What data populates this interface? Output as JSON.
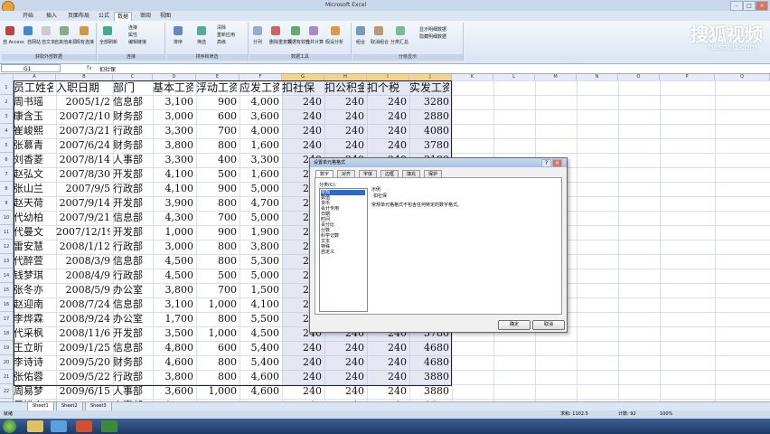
{
  "window": {
    "title": "Microsoft Excel"
  },
  "ribbon": {
    "tabs": [
      "开始",
      "插入",
      "页面布局",
      "公式",
      "数据",
      "审阅",
      "视图"
    ],
    "active_tab": "数据",
    "groups": [
      {
        "label": "获取外部数据",
        "buttons": [
          "自 Access",
          "自网站",
          "自文本",
          "自其他来源",
          "现有连接"
        ]
      },
      {
        "label": "连接",
        "buttons": [
          "全部刷新",
          "连接",
          "属性",
          "编辑链接"
        ]
      },
      {
        "label": "排序和筛选",
        "buttons": [
          "排序",
          "筛选",
          "清除",
          "重新应用",
          "高级"
        ]
      },
      {
        "label": "数据工具",
        "buttons": [
          "分列",
          "删除重复项",
          "数据有效性",
          "合并计算",
          "假设分析"
        ]
      },
      {
        "label": "分级显示",
        "buttons": [
          "组合",
          "取消组合",
          "分类汇总",
          "显示明细数据",
          "隐藏明细数据"
        ]
      }
    ]
  },
  "watermark": {
    "brand": "搜狐视频",
    "url": "tv.sohu.com"
  },
  "formula_bar": {
    "name_box": "G1",
    "fx": "fx",
    "value": "扣社保"
  },
  "columns": [
    "A",
    "B",
    "C",
    "D",
    "E",
    "F",
    "G",
    "H",
    "I",
    "J",
    "K",
    "L",
    "M",
    "N",
    "O",
    "P",
    "Q"
  ],
  "row_numbers": [
    "1",
    "2",
    "3",
    "4",
    "5",
    "6",
    "7",
    "8",
    "9",
    "10",
    "11",
    "12",
    "13",
    "14",
    "15",
    "16",
    "17",
    "18",
    "19",
    "20",
    "21",
    "22"
  ],
  "table": {
    "headers": [
      "员工姓名",
      "入职日期",
      "部门",
      "基本工资",
      "浮动工资",
      "应发工资",
      "扣社保",
      "扣公积金",
      "扣个税",
      "实发工资"
    ],
    "rows": [
      [
        "周书瑶",
        "2005/1/2",
        "信息部",
        "3,100",
        "900",
        "4,000",
        "240",
        "240",
        "240",
        "3280"
      ],
      [
        "康含玉",
        "2007/2/10",
        "财务部",
        "3,000",
        "600",
        "3,600",
        "240",
        "240",
        "240",
        "2880"
      ],
      [
        "崔峻熙",
        "2007/3/21",
        "行政部",
        "3,300",
        "700",
        "4,000",
        "240",
        "240",
        "240",
        "4080"
      ],
      [
        "张慕青",
        "2007/6/24",
        "财务部",
        "3,800",
        "800",
        "1,600",
        "240",
        "240",
        "240",
        "3780"
      ],
      [
        "刘香菱",
        "2007/8/14",
        "人事部",
        "3,300",
        "400",
        "3,300",
        "240",
        "240",
        "240",
        "3180"
      ],
      [
        "赵弘文",
        "2007/8/30",
        "开发部",
        "4,100",
        "500",
        "1,600",
        "240",
        "240",
        "240",
        "3880"
      ],
      [
        "张山兰",
        "2007/9/5",
        "行政部",
        "4,100",
        "900",
        "5,000",
        "240",
        "240",
        "240",
        "4180"
      ],
      [
        "赵天荷",
        "2007/9/14",
        "开发部",
        "3,900",
        "800",
        "4,700",
        "240",
        "240",
        "240",
        "3980"
      ],
      [
        "代幼柏",
        "2007/9/21",
        "信息部",
        "4,300",
        "700",
        "5,000",
        "240",
        "240",
        "240",
        "4280"
      ],
      [
        "代曼文",
        "2007/12/19",
        "开发部",
        "1,000",
        "900",
        "1,900",
        "240",
        "240",
        "240",
        "1180"
      ],
      [
        "雷安慧",
        "2008/1/12",
        "行政部",
        "3,000",
        "800",
        "3,800",
        "240",
        "240",
        "240",
        "3080"
      ],
      [
        "代醉萱",
        "2008/3/9",
        "信息部",
        "4,500",
        "800",
        "5,300",
        "240",
        "240",
        "240",
        "4580"
      ],
      [
        "钱梦琪",
        "2008/4/9",
        "行政部",
        "4,500",
        "500",
        "5,000",
        "240",
        "240",
        "240",
        "4280"
      ],
      [
        "张冬亦",
        "2008/5/9",
        "办公室",
        "3,800",
        "700",
        "1,500",
        "240",
        "240",
        "240",
        "3780"
      ],
      [
        "赵迎南",
        "2008/7/24",
        "信息部",
        "3,100",
        "1,000",
        "4,100",
        "240",
        "240",
        "240",
        "3380"
      ],
      [
        "李烨霖",
        "2008/9/24",
        "办公室",
        "1,700",
        "800",
        "5,500",
        "240",
        "240",
        "240",
        "4780"
      ],
      [
        "代采枫",
        "2008/11/6",
        "开发部",
        "3,500",
        "1,000",
        "4,500",
        "240",
        "240",
        "240",
        "3780"
      ],
      [
        "王立昕",
        "2009/1/25",
        "信息部",
        "4,800",
        "600",
        "5,400",
        "240",
        "240",
        "240",
        "4680"
      ],
      [
        "李诗诗",
        "2009/5/20",
        "财务部",
        "4,600",
        "800",
        "5,400",
        "240",
        "240",
        "240",
        "4680"
      ],
      [
        "张佑蓉",
        "2009/5/22",
        "行政部",
        "3,800",
        "800",
        "4,600",
        "240",
        "240",
        "240",
        "3880"
      ],
      [
        "周易梦",
        "2009/6/15",
        "人事部",
        "3,600",
        "1,000",
        "4,600",
        "240",
        "240",
        "240",
        "3880"
      ],
      [
        "周惜文",
        "2009/7/13",
        "人事部",
        "1,300",
        "900",
        "5,200",
        "240",
        "240",
        "240",
        "4480"
      ]
    ]
  },
  "dialog": {
    "title": "设置单元格格式",
    "tabs": [
      "数字",
      "对齐",
      "字体",
      "边框",
      "填充",
      "保护"
    ],
    "category_label": "分类(C):",
    "categories": [
      "常规",
      "数值",
      "货币",
      "会计专用",
      "日期",
      "时间",
      "百分比",
      "分数",
      "科学记数",
      "文本",
      "特殊",
      "自定义"
    ],
    "selected_category": "常规",
    "sample_label": "示例",
    "sample_value": "扣社保",
    "description": "常规单元格格式不包含任何特定的数字格式。",
    "ok": "确定",
    "cancel": "取消"
  },
  "sheets": [
    "Sheet1",
    "Sheet2",
    "Sheet3"
  ],
  "status": {
    "left": "就绪",
    "sum": "求和: 1102.5",
    "count": "计数: 92",
    "zoom": "100%"
  }
}
